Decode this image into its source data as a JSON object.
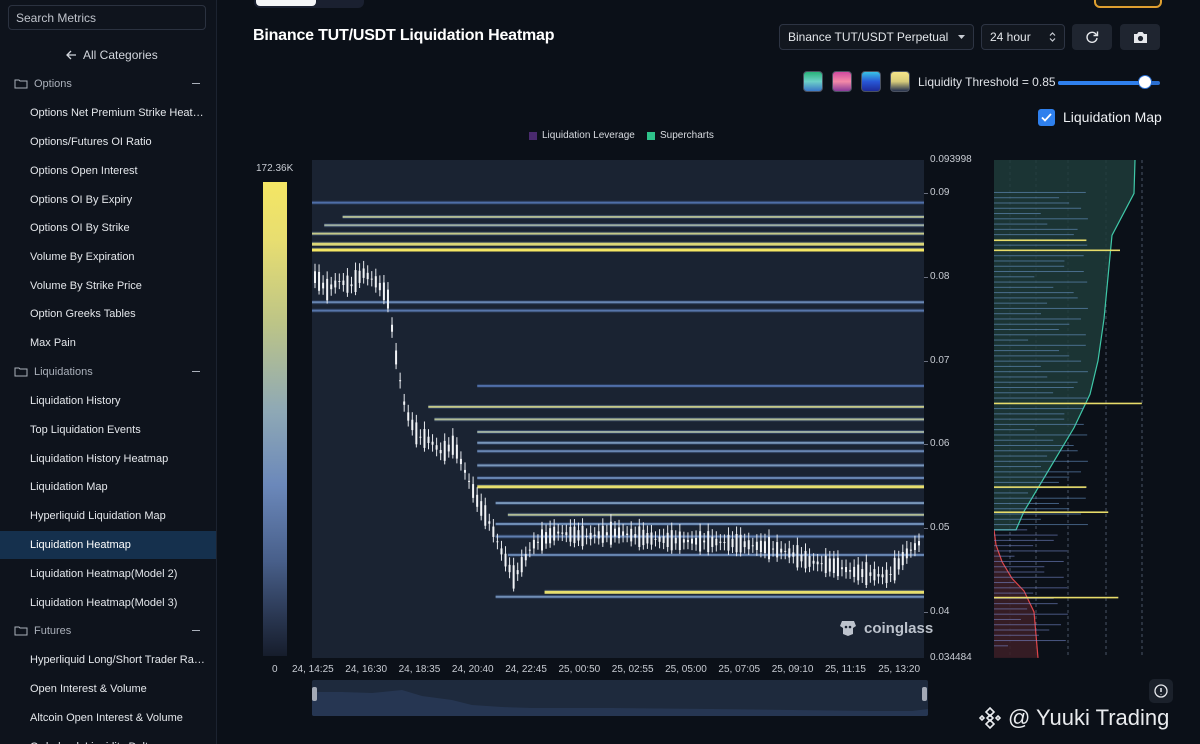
{
  "sidebar": {
    "search_placeholder": "Search Metrics",
    "all_categories": "All Categories",
    "groups": [
      "Options",
      "Liquidations",
      "Futures"
    ],
    "items": [
      "Options Net Premium Strike Heat…",
      "Options/Futures OI Ratio",
      "Options Open Interest",
      "Options OI By Expiry",
      "Options OI By Strike",
      "Volume By Expiration",
      "Volume By Strike Price",
      "Option Greeks Tables",
      "Max Pain",
      "Liquidation History",
      "Top Liquidation Events",
      "Liquidation History Heatmap",
      "Liquidation Map",
      "Hyperliquid Liquidation Map",
      "Liquidation Heatmap",
      "Liquidation Heatmap(Model 2)",
      "Liquidation Heatmap(Model 3)",
      "Hyperliquid Long/Short Trader Ra…",
      "Open Interest & Volume",
      "Altcoin Open Interest & Volume",
      "Orderbook Liquidity Delta"
    ],
    "active_item": "Liquidation Heatmap"
  },
  "header": {
    "title": "Binance TUT/USDT Liquidation Heatmap",
    "pair_select": "Binance TUT/USDT Perpetual",
    "interval_select": "24 hour",
    "liquidity_threshold_label": "Liquidity Threshold = 0.85",
    "liquidity_threshold": 0.85,
    "liquidation_map_label": "Liquidation Map",
    "liquidation_map_checked": true,
    "color_schemes": [
      "green-blue",
      "magenta-pink",
      "blue-cyan",
      "yellow-navy"
    ]
  },
  "chart_data": {
    "type": "heatmap",
    "legend": [
      "Liquidation Leverage",
      "Supercharts"
    ],
    "legend_colors": [
      "#4a2a6e",
      "#2ec28a"
    ],
    "colorbar_max": "172.36K",
    "colorbar_min": "0",
    "y_top_label": "0.093998",
    "y_bottom_label": "0.034484",
    "y_ticks": [
      "0.09",
      "0.08",
      "0.07",
      "0.06",
      "0.05",
      "0.04"
    ],
    "ylim": [
      0.034484,
      0.093998
    ],
    "x_ticks": [
      "24, 14:25",
      "24, 16:30",
      "24, 18:35",
      "24, 20:40",
      "24, 22:45",
      "25, 00:50",
      "25, 02:55",
      "25, 05:00",
      "25, 07:05",
      "25, 09:10",
      "25, 11:15",
      "25, 13:20"
    ],
    "price_path": [
      [
        0.0,
        0.08
      ],
      [
        0.02,
        0.0785
      ],
      [
        0.04,
        0.0795
      ],
      [
        0.06,
        0.079
      ],
      [
        0.08,
        0.0805
      ],
      [
        0.1,
        0.0795
      ],
      [
        0.12,
        0.0778
      ],
      [
        0.135,
        0.07
      ],
      [
        0.15,
        0.064
      ],
      [
        0.17,
        0.061
      ],
      [
        0.19,
        0.0605
      ],
      [
        0.21,
        0.059
      ],
      [
        0.23,
        0.06
      ],
      [
        0.25,
        0.0565
      ],
      [
        0.27,
        0.053
      ],
      [
        0.29,
        0.0505
      ],
      [
        0.31,
        0.047
      ],
      [
        0.33,
        0.044
      ],
      [
        0.36,
        0.048
      ],
      [
        0.4,
        0.0495
      ],
      [
        0.45,
        0.049
      ],
      [
        0.5,
        0.0495
      ],
      [
        0.55,
        0.0488
      ],
      [
        0.6,
        0.0485
      ],
      [
        0.65,
        0.0484
      ],
      [
        0.7,
        0.0482
      ],
      [
        0.74,
        0.0478
      ],
      [
        0.78,
        0.0472
      ],
      [
        0.82,
        0.046
      ],
      [
        0.86,
        0.0455
      ],
      [
        0.89,
        0.0448
      ],
      [
        0.92,
        0.0445
      ],
      [
        0.95,
        0.0442
      ],
      [
        0.98,
        0.047
      ],
      [
        1.0,
        0.0482
      ]
    ],
    "liquidation_levels": [
      {
        "price": 0.0889,
        "start": 0.0,
        "intensity": 0.35
      },
      {
        "price": 0.0872,
        "start": 0.05,
        "intensity": 0.75
      },
      {
        "price": 0.0862,
        "start": 0.02,
        "intensity": 0.7
      },
      {
        "price": 0.0852,
        "start": 0.0,
        "intensity": 0.8
      },
      {
        "price": 0.084,
        "start": 0.0,
        "intensity": 0.9
      },
      {
        "price": 0.0833,
        "start": 0.0,
        "intensity": 1.0
      },
      {
        "price": 0.077,
        "start": 0.0,
        "intensity": 0.5
      },
      {
        "price": 0.076,
        "start": 0.0,
        "intensity": 0.4
      },
      {
        "price": 0.067,
        "start": 0.27,
        "intensity": 0.35
      },
      {
        "price": 0.0645,
        "start": 0.19,
        "intensity": 0.8
      },
      {
        "price": 0.063,
        "start": 0.2,
        "intensity": 0.75
      },
      {
        "price": 0.0615,
        "start": 0.27,
        "intensity": 0.7
      },
      {
        "price": 0.0602,
        "start": 0.27,
        "intensity": 0.6
      },
      {
        "price": 0.0592,
        "start": 0.27,
        "intensity": 0.5
      },
      {
        "price": 0.0575,
        "start": 0.27,
        "intensity": 0.6
      },
      {
        "price": 0.056,
        "start": 0.27,
        "intensity": 0.5
      },
      {
        "price": 0.055,
        "start": 0.27,
        "intensity": 0.95
      },
      {
        "price": 0.053,
        "start": 0.3,
        "intensity": 0.6
      },
      {
        "price": 0.0516,
        "start": 0.32,
        "intensity": 0.75
      },
      {
        "price": 0.0505,
        "start": 0.3,
        "intensity": 0.55
      },
      {
        "price": 0.049,
        "start": 0.3,
        "intensity": 0.45
      },
      {
        "price": 0.0468,
        "start": 0.32,
        "intensity": 0.5
      },
      {
        "price": 0.0424,
        "start": 0.38,
        "intensity": 0.95
      },
      {
        "price": 0.0418,
        "start": 0.3,
        "intensity": 0.55
      }
    ],
    "side_levels": [
      {
        "price": 0.0845,
        "length": 0.55
      },
      {
        "price": 0.0833,
        "length": 0.75
      },
      {
        "price": 0.065,
        "length": 0.88
      },
      {
        "price": 0.055,
        "length": 0.55
      },
      {
        "price": 0.052,
        "length": 0.68
      },
      {
        "price": 0.0418,
        "length": 0.74
      }
    ]
  },
  "watermark": "coinglass",
  "credit": "@ Yuuki Trading"
}
